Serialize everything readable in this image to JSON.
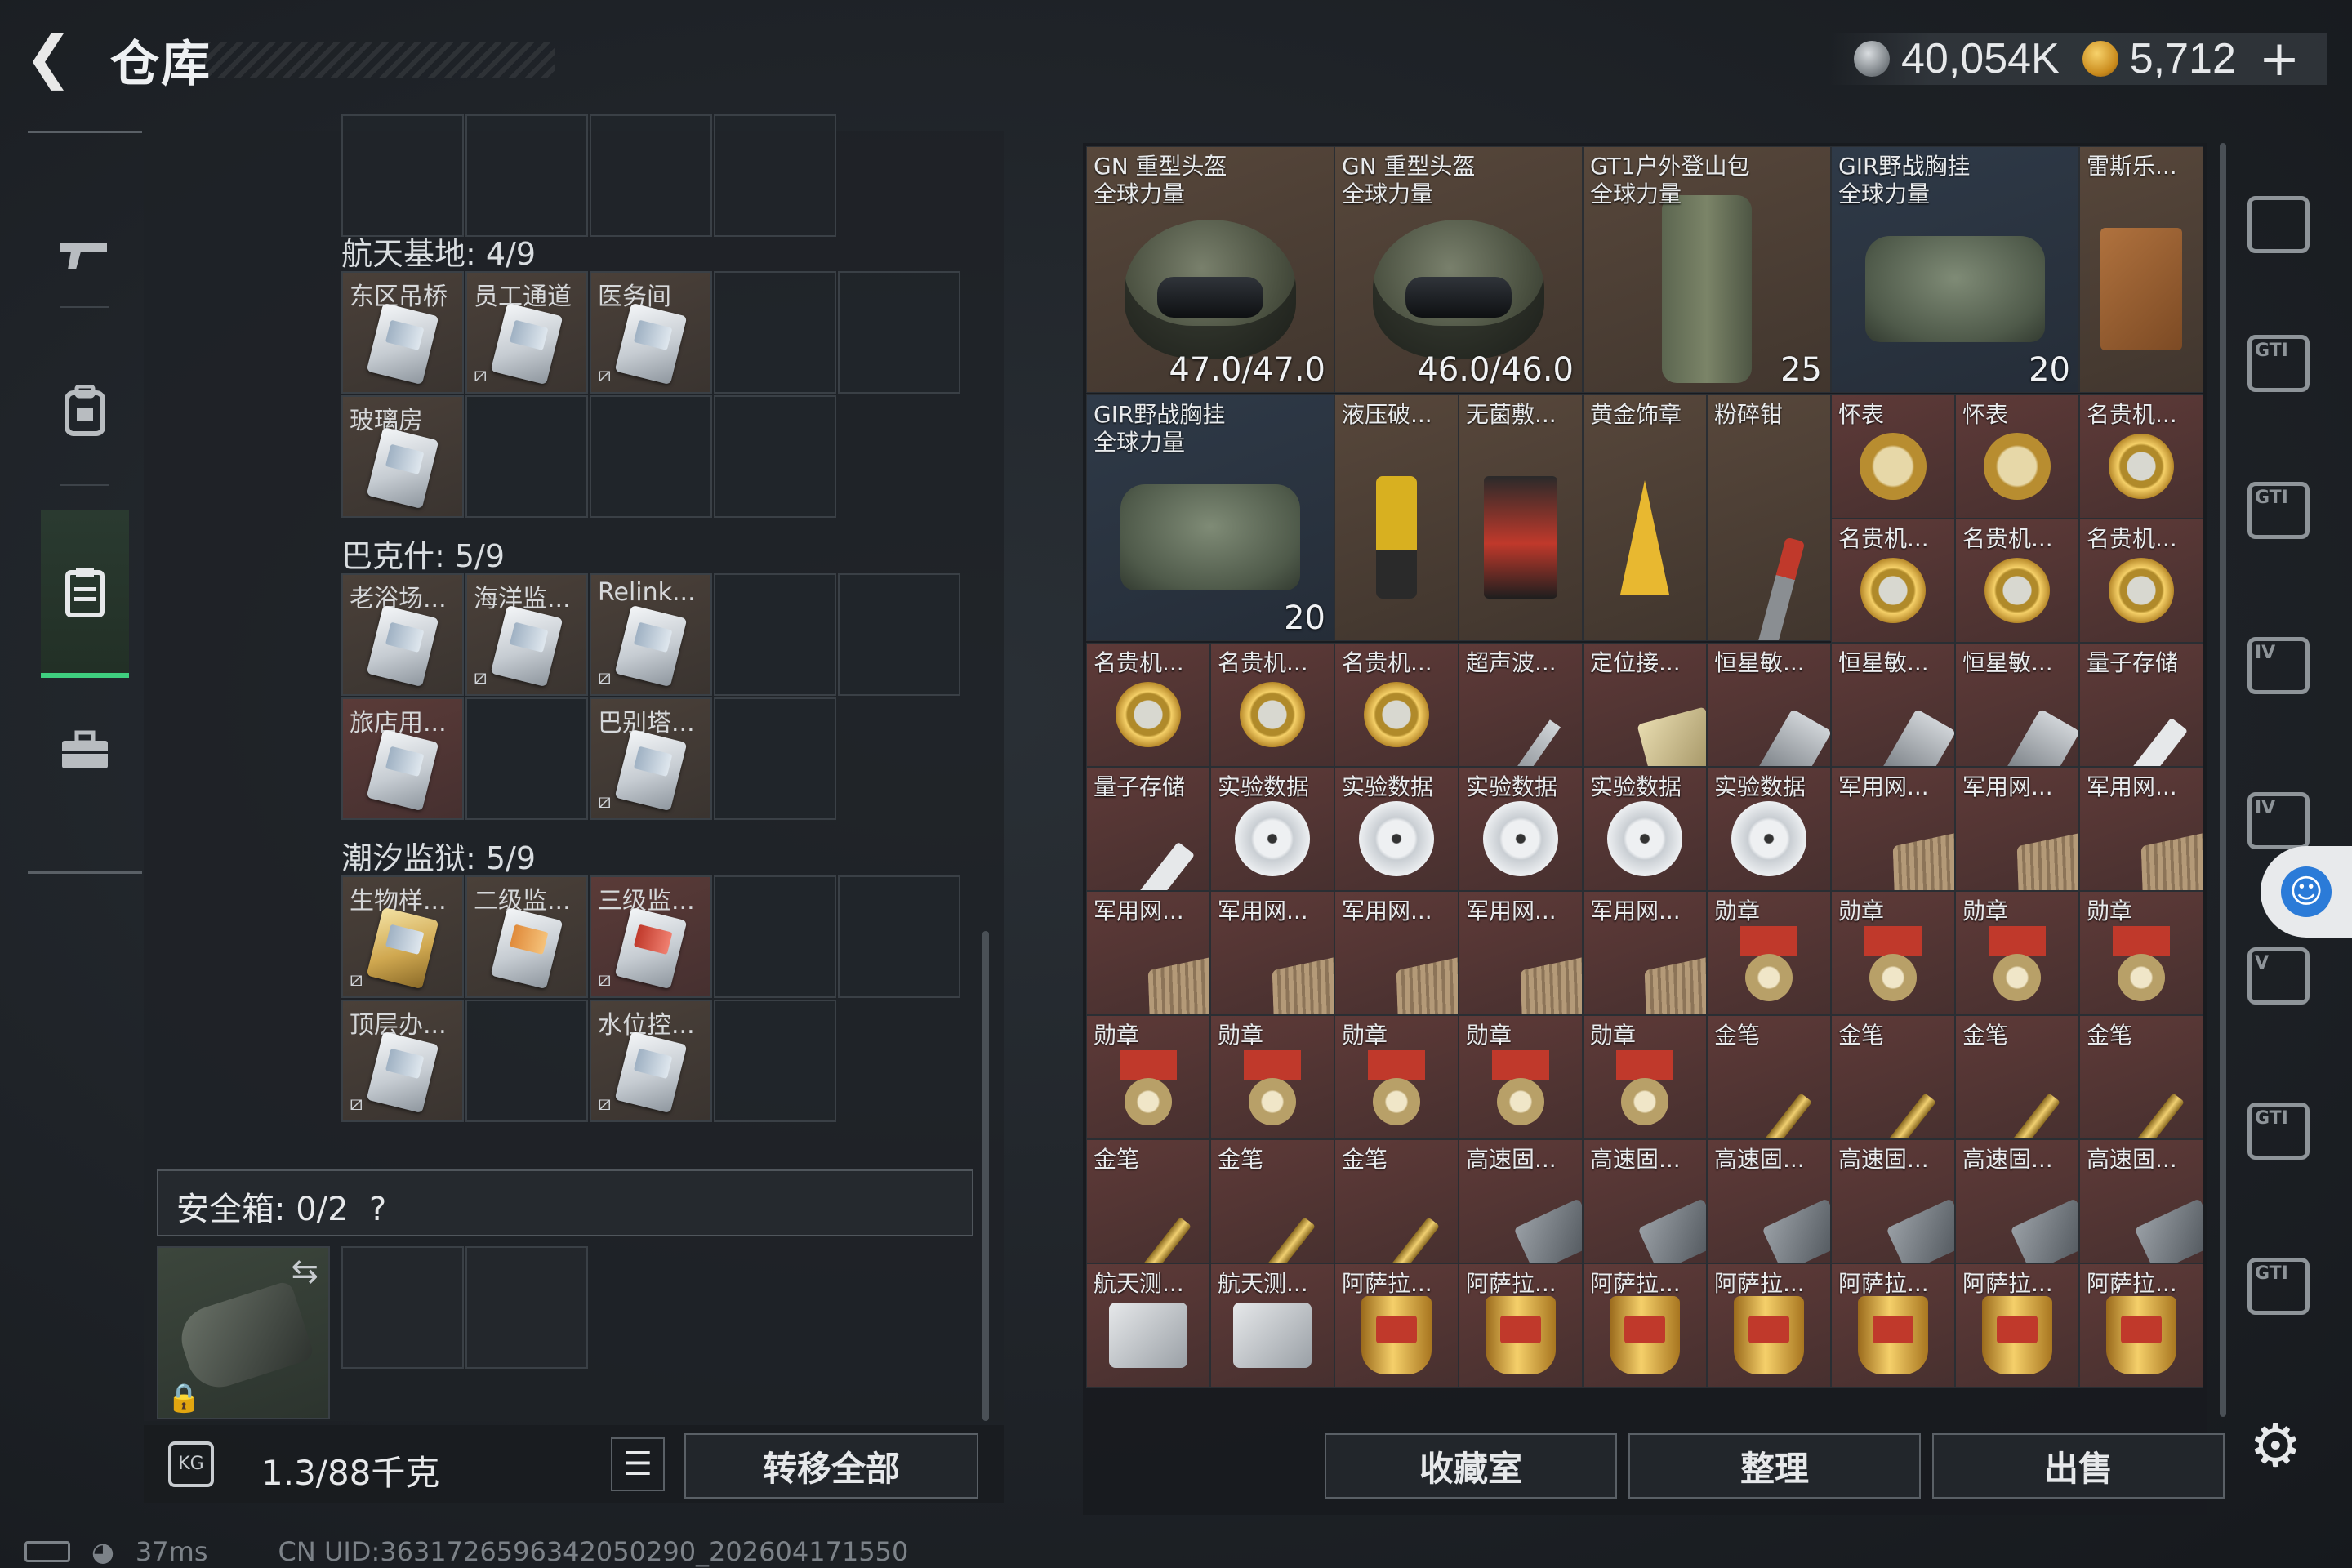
{
  "header": {
    "title": "仓库"
  },
  "currency": {
    "coin1_value": "40,054K",
    "coin2_value": "5,712",
    "plus": "+"
  },
  "left_nav": {
    "icons": [
      "gun-icon",
      "backpack-icon",
      "clipboard-icon",
      "toolbox-icon"
    ],
    "active_index": 2
  },
  "sections": [
    {
      "title": "航天基地: 4/9",
      "items": [
        "东区吊桥",
        "员工通道",
        "医务间",
        "玻璃房"
      ]
    },
    {
      "title": "巴克什: 5/9",
      "items": [
        "老浴场...",
        "海洋监...",
        "Relink...",
        "旅店用...",
        "巴别塔..."
      ]
    },
    {
      "title": "潮汐监狱: 5/9",
      "items": [
        "生物样...",
        "二级监...",
        "三级监...",
        "顶层办...",
        "水位控..."
      ]
    }
  ],
  "safebox": {
    "label": "安全箱: 0/2",
    "help": "?"
  },
  "capacity": {
    "weight": "1.3/88千克"
  },
  "buttons": {
    "transfer_all": "转移全部",
    "collection": "收藏室",
    "organize": "整理",
    "sell": "出售"
  },
  "inventory_top": [
    {
      "name": "GN 重型头盔",
      "sub": "全球力量",
      "value": "47.0/47.0"
    },
    {
      "name": "GN 重型头盔",
      "sub": "全球力量",
      "value": "46.0/46.0"
    },
    {
      "name": "GT1户外登山包",
      "sub": "全球力量",
      "value": "25"
    },
    {
      "name": "GIR野战胸挂",
      "sub": "全球力量",
      "value": "20"
    },
    {
      "name": "雷斯乐..."
    },
    {
      "name": "GIR野战胸挂",
      "sub": "全球力量",
      "value": "20"
    },
    {
      "name": "液压破..."
    },
    {
      "name": "无菌敷..."
    },
    {
      "name": "黄金饰章"
    },
    {
      "name": "粉碎钳"
    },
    {
      "name": "怀表"
    },
    {
      "name": "怀表"
    },
    {
      "name": "名贵机..."
    }
  ],
  "inventory_rows": [
    [
      "名贵机...",
      "名贵机...",
      "名贵机..."
    ],
    [
      "名贵机...",
      "名贵机...",
      "名贵机...",
      "超声波...",
      "定位接...",
      "恒星敏...",
      "恒星敏...",
      "恒星敏...",
      "量子存储"
    ],
    [
      "量子存储",
      "实验数据",
      "实验数据",
      "实验数据",
      "实验数据",
      "实验数据",
      "军用网...",
      "军用网...",
      "军用网..."
    ],
    [
      "军用网...",
      "军用网...",
      "军用网...",
      "军用网...",
      "军用网...",
      "勋章",
      "勋章",
      "勋章",
      "勋章"
    ],
    [
      "勋章",
      "勋章",
      "勋章",
      "勋章",
      "勋章",
      "金笔",
      "金笔",
      "金笔",
      "金笔"
    ],
    [
      "金笔",
      "金笔",
      "金笔",
      "高速固...",
      "高速固...",
      "高速固...",
      "高速固...",
      "高速固...",
      "高速固..."
    ],
    [
      "航天测...",
      "航天测...",
      "阿萨拉...",
      "阿萨拉...",
      "阿萨拉...",
      "阿萨拉...",
      "阿萨拉...",
      "阿萨拉...",
      "阿萨拉..."
    ]
  ],
  "right_sidebar": {
    "labels": [
      "GTI",
      "GTI",
      "IV",
      "IV",
      "V",
      "GTI",
      "GTI"
    ]
  },
  "status": {
    "ping": "37ms",
    "uid": "CN UID:3631726596342050290_202604171550"
  }
}
